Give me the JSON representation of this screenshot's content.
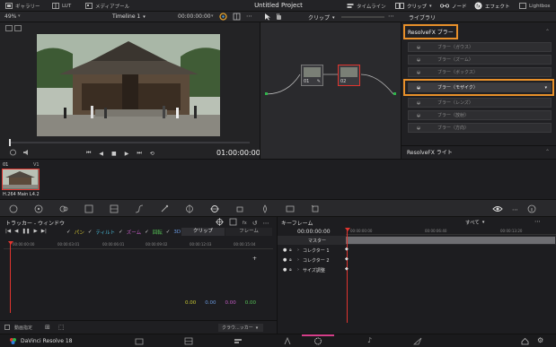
{
  "topbar": {
    "gallery": "ギャラリー",
    "lut": "LUT",
    "media_pool": "メディアプール",
    "project_title": "Untitled Project",
    "timeline": "タイムライン",
    "clips": "クリップ",
    "nodes": "ノード",
    "effects": "エフェクト",
    "lightbox": "Lightbox"
  },
  "viewbar": {
    "zoom": "49%",
    "timeline_name": "Timeline 1",
    "timecode": "00:00:00:00",
    "clip_mode": "クリップ",
    "library_label": "ライブラリ"
  },
  "viewer": {
    "timecode": "01:00:00:00"
  },
  "nodes": [
    {
      "label": "01"
    },
    {
      "label": "02"
    }
  ],
  "library": {
    "section1_title": "ResolveFX ブラー",
    "items": [
      {
        "label": "ブラー（ガウス）"
      },
      {
        "label": "ブラー（ズーム）"
      },
      {
        "label": "ブラー（ボックス）"
      },
      {
        "label": "ブラー（モザイク）"
      },
      {
        "label": "ブラー（レンズ）"
      },
      {
        "label": "ブラー（放射）"
      },
      {
        "label": "ブラー（方向）"
      }
    ],
    "section2_title": "ResolveFX ライト"
  },
  "clipstrip": {
    "clip_number": "01",
    "track": "V1",
    "codec": "H.264 Main L4.2"
  },
  "tracker": {
    "title": "トラッカー - ウィンドウ",
    "options": [
      "パン",
      "ティルト",
      "ズーム",
      "回転",
      "3D"
    ],
    "tabs": [
      "クリップ",
      "フレーム"
    ],
    "ticks": [
      "00:00:00:00",
      "00:00:03:01",
      "00:00:06:01",
      "00:00:09:02",
      "00:00:12:03",
      "00:00:15:04"
    ],
    "values": [
      "0.00",
      "0.00",
      "0.00",
      "0.00"
    ],
    "analysis_label": "動画指定",
    "mode_select": "クラウ...ッカー"
  },
  "keyframes": {
    "title": "キーフレーム",
    "filter": "すべて",
    "timecode": "00:00:00:00",
    "ticks": [
      "00:00:00:00",
      "00:00:06:40",
      "00:00:13:20"
    ],
    "tracks": [
      "マスター",
      "コレクター 1",
      "コレクター 2",
      "サイズ調整"
    ]
  },
  "footer": {
    "app_name": "DaVinci Resolve 18"
  },
  "colors": {
    "accent_orange": "#e8902a",
    "playhead_red": "#e0352f",
    "selection": "#d8732c"
  }
}
